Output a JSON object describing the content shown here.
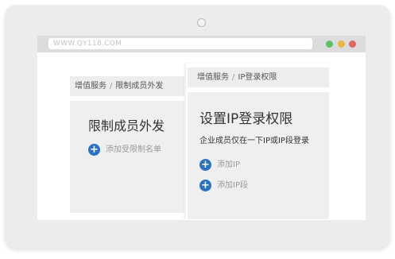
{
  "browser": {
    "url": "WWW.QY118.COM",
    "colors": {
      "green": "#5ebf6b",
      "yellow": "#e8b743",
      "red": "#e06464"
    }
  },
  "left_panel": {
    "breadcrumb": [
      "增值服务",
      "限制成员外发"
    ],
    "title": "限制成员外发",
    "action_label": "添加受限制名单"
  },
  "right_panel": {
    "breadcrumb": [
      "增值服务",
      "IP登录权限"
    ],
    "title": "设置IP登录权限",
    "subtitle": "企业成员仅在一下IP或IP段登录",
    "actions": [
      {
        "label": "添加IP"
      },
      {
        "label": "添加IP段"
      }
    ]
  },
  "breadcrumb_separator": "/",
  "icons": {
    "add": "plus-circle-icon"
  },
  "accent_color": "#2a72c3"
}
